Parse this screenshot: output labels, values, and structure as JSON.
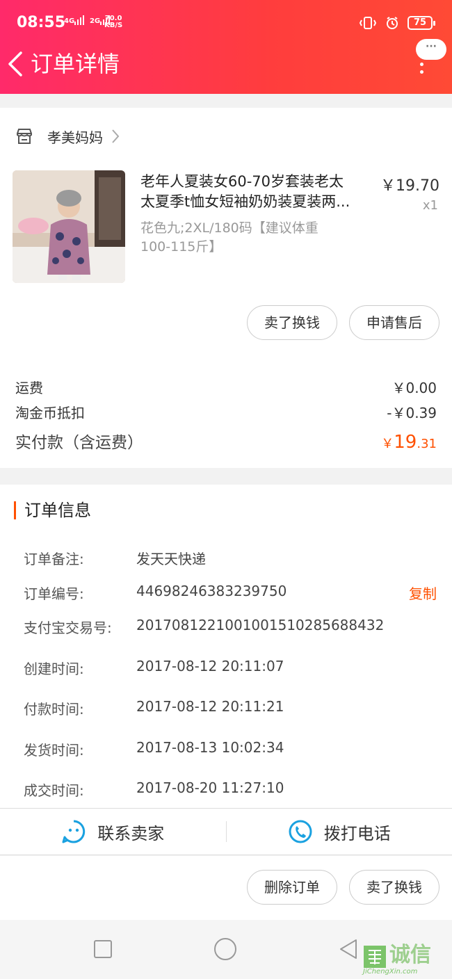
{
  "status_bar": {
    "time": "08:55",
    "signal_1": "4G",
    "signal_2": "2G",
    "net_speed_value": "70.0",
    "net_speed_unit": "KB/S",
    "battery": "75"
  },
  "header": {
    "title": "订单详情",
    "more_bubble": "···"
  },
  "shop": {
    "name": "孝美妈妈"
  },
  "product": {
    "title_line1": "老年人夏装女60-70岁套装老太",
    "title_line2": "太夏季t恤女短袖奶奶装夏装两...",
    "price": "￥19.70",
    "qty": "x1",
    "spec_line1": "花色九;2XL/180码【建议体重",
    "spec_line2": "100-115斤】",
    "buttons": [
      "卖了换钱",
      "申请售后"
    ]
  },
  "summary": {
    "shipping_label": "运费",
    "shipping_value": "￥0.00",
    "coin_label": "淘金币抵扣",
    "coin_value": "-￥0.39",
    "total_label": "实付款（含运费）",
    "total_symbol": "￥",
    "total_int": "19",
    "total_dec": ".31"
  },
  "order_info": {
    "title": "订单信息",
    "copy_label": "复制",
    "rows": [
      {
        "label": "订单备注:",
        "value": "发天天快递"
      },
      {
        "label": "订单编号:",
        "value": "44698246383239750"
      },
      {
        "label": "支付宝交易号:",
        "value": "2017081221001001510285688432"
      },
      {
        "label": "创建时间:",
        "value": "2017-08-12 20:11:07"
      },
      {
        "label": "付款时间:",
        "value": "2017-08-12 20:11:21"
      },
      {
        "label": "发货时间:",
        "value": "2017-08-13 10:02:34"
      },
      {
        "label": "成交时间:",
        "value": "2017-08-20 11:27:10"
      }
    ]
  },
  "contact": {
    "seller_label": "联系卖家",
    "phone_label": "拨打电话"
  },
  "actions": {
    "delete_label": "删除订单",
    "resell_label": "卖了换钱"
  },
  "watermark": {
    "text": "诚信",
    "url": "JiChengXin.com"
  },
  "colors": {
    "accent": "#ff5000",
    "header_start": "#ff2a6a",
    "header_end": "#ff4a35",
    "contact_icon": "#1aa1e0"
  }
}
